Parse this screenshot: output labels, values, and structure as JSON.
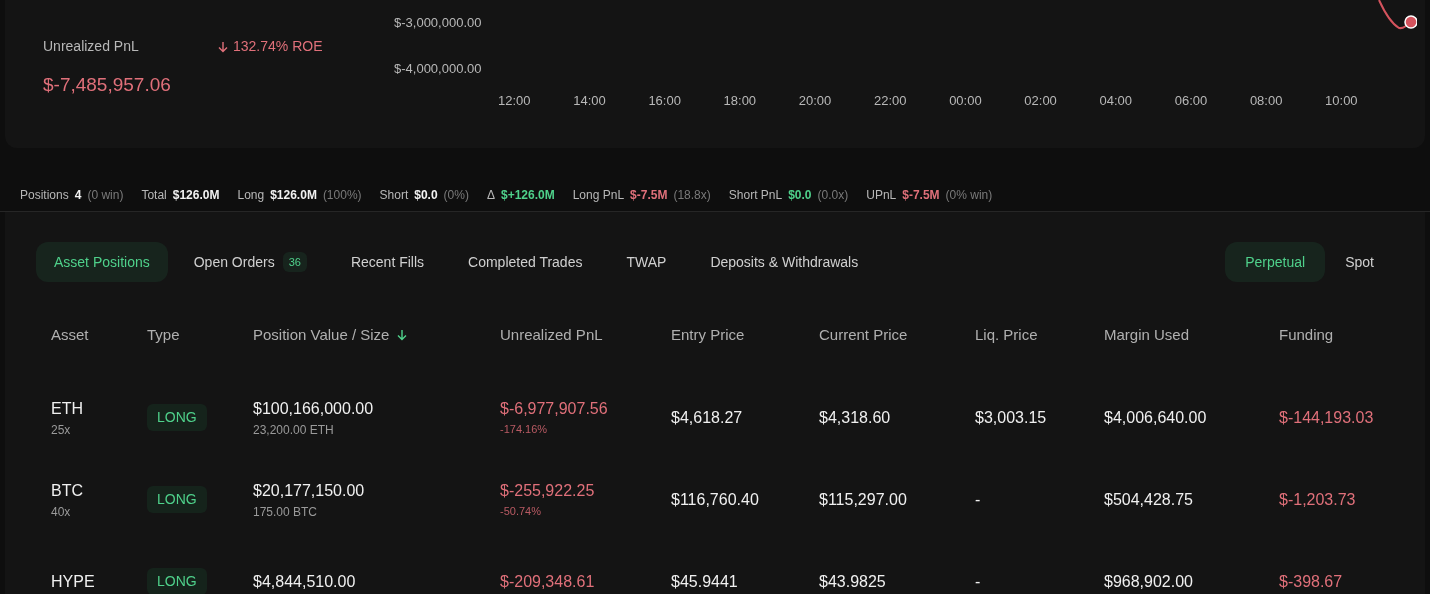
{
  "summary": {
    "label": "Unrealized PnL",
    "roe": "132.74% ROE",
    "value": "$-7,485,957.06"
  },
  "chart": {
    "yticks": [
      "$-3,000,000.00",
      "$-4,000,000.00"
    ],
    "xticks": [
      "12:00",
      "14:00",
      "16:00",
      "18:00",
      "20:00",
      "22:00",
      "00:00",
      "02:00",
      "04:00",
      "06:00",
      "08:00",
      "10:00"
    ]
  },
  "stats": [
    {
      "label": "Positions",
      "value": "4",
      "color": "#f2f2f2",
      "note": "(0 win)"
    },
    {
      "label": "Total",
      "value": "$126.0M",
      "color": "#f2f2f2"
    },
    {
      "label": "Long",
      "value": "$126.0M",
      "color": "#f2f2f2",
      "note": "(100%)"
    },
    {
      "label": "Short",
      "value": "$0.0",
      "color": "#f2f2f2",
      "note": "(0%)"
    },
    {
      "label": "Δ",
      "value": "$+126.0M",
      "color": "#4fd18b"
    },
    {
      "label": "Long PnL",
      "value": "$-7.5M",
      "color": "#e0707a",
      "note": "(18.8x)"
    },
    {
      "label": "Short PnL",
      "value": "$0.0",
      "color": "#4fd18b",
      "note": "(0.0x)"
    },
    {
      "label": "UPnL",
      "value": "$-7.5M",
      "color": "#e0707a",
      "note": "(0% win)"
    }
  ],
  "tabs": [
    {
      "label": "Asset Positions",
      "selected": true
    },
    {
      "label": "Open Orders",
      "count": "36",
      "selected": false
    },
    {
      "label": "Recent Fills",
      "selected": false
    },
    {
      "label": "Completed Trades",
      "selected": false
    },
    {
      "label": "TWAP",
      "selected": false
    },
    {
      "label": "Deposits & Withdrawals",
      "selected": false
    }
  ],
  "market_tabs": [
    {
      "label": "Perpetual",
      "selected": true
    },
    {
      "label": "Spot",
      "selected": false
    }
  ],
  "table": {
    "columns": [
      {
        "label": "Asset"
      },
      {
        "label": "Type"
      },
      {
        "label": "Position Value / Size",
        "sorted": true
      },
      {
        "label": "Unrealized PnL"
      },
      {
        "label": "Entry Price"
      },
      {
        "label": "Current Price"
      },
      {
        "label": "Liq. Price"
      },
      {
        "label": "Margin Used"
      },
      {
        "label": "Funding"
      }
    ],
    "rows": [
      {
        "asset": "ETH",
        "leverage": "25x",
        "type": "LONG",
        "value": "$100,166,000.00",
        "size": "23,200.00 ETH",
        "pnl": "$-6,977,907.56",
        "pnl_pct": "-174.16%",
        "entry": "$4,618.27",
        "current": "$4,318.60",
        "liq": "$3,003.15",
        "margin": "$4,006,640.00",
        "funding": "$-144,193.03"
      },
      {
        "asset": "BTC",
        "leverage": "40x",
        "type": "LONG",
        "value": "$20,177,150.00",
        "size": "175.00 BTC",
        "pnl": "$-255,922.25",
        "pnl_pct": "-50.74%",
        "entry": "$116,760.40",
        "current": "$115,297.00",
        "liq": "-",
        "margin": "$504,428.75",
        "funding": "$-1,203.73"
      },
      {
        "asset": "HYPE",
        "type": "LONG",
        "value": "$4,844,510.00",
        "pnl": "$-209,348.61",
        "entry": "$45.9441",
        "current": "$43.9825",
        "liq": "-",
        "margin": "$968,902.00",
        "funding": "$-398.67"
      }
    ]
  }
}
